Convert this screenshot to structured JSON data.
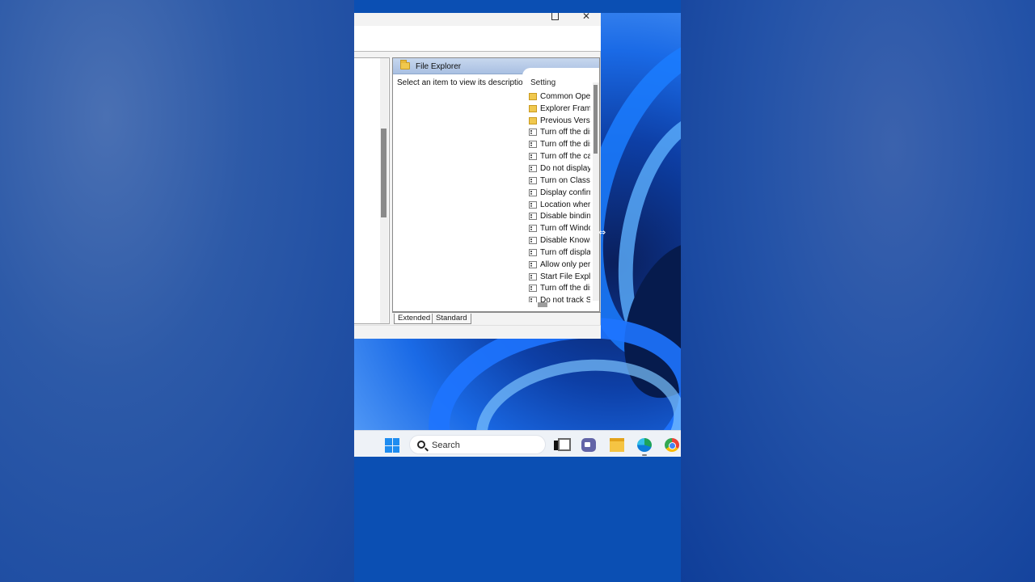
{
  "colors": {
    "background": "#1d4fa8",
    "pane_header": "#b8cbe8",
    "taskbar": "#eef2f7",
    "start_accent": "#1e8cf0"
  },
  "window": {
    "controls": {
      "maximize": "☐",
      "close": "✕"
    }
  },
  "right_pane": {
    "header_icon": "folder-icon",
    "title": "File Explorer",
    "description": "Select an item to view its description.",
    "column_header": "Setting",
    "items": [
      {
        "icon": "folder-icon",
        "label": "Common Oper"
      },
      {
        "icon": "folder-icon",
        "label": "Explorer Frame"
      },
      {
        "icon": "folder-icon",
        "label": "Previous Versio"
      },
      {
        "icon": "policy-setting-icon",
        "label": "Turn off the dis"
      },
      {
        "icon": "policy-setting-icon",
        "label": "Turn off the dis"
      },
      {
        "icon": "policy-setting-icon",
        "label": "Turn off the ca"
      },
      {
        "icon": "policy-setting-icon",
        "label": "Do not display"
      },
      {
        "icon": "policy-setting-icon",
        "label": "Turn on Classic"
      },
      {
        "icon": "policy-setting-icon",
        "label": "Display confirm"
      },
      {
        "icon": "policy-setting-icon",
        "label": "Location where"
      },
      {
        "icon": "policy-setting-icon",
        "label": "Disable binding"
      },
      {
        "icon": "policy-setting-icon",
        "label": "Turn off Windo"
      },
      {
        "icon": "policy-setting-icon",
        "label": "Disable Known"
      },
      {
        "icon": "policy-setting-icon",
        "label": "Turn off displa"
      },
      {
        "icon": "policy-setting-icon",
        "label": "Allow only per"
      },
      {
        "icon": "policy-setting-icon",
        "label": "Start File Explo"
      },
      {
        "icon": "policy-setting-icon",
        "label": "Turn off the dis"
      },
      {
        "icon": "policy-setting-icon",
        "label": "Do not track Sh"
      }
    ]
  },
  "tabs": [
    {
      "label": "Extended",
      "selected": true
    },
    {
      "label": "Standard",
      "selected": false
    }
  ],
  "taskbar": {
    "search_label": "Search",
    "icons": [
      "windows-start-icon",
      "search-icon",
      "task-view-icon",
      "teams-chat-icon",
      "file-explorer-icon",
      "edge-icon",
      "chrome-icon"
    ]
  }
}
